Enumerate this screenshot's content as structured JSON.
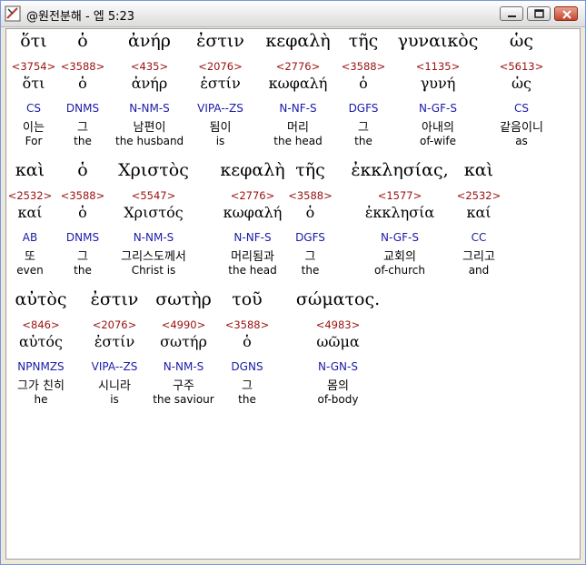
{
  "window": {
    "title": "@원전분해 - 엡 5:23"
  },
  "lines": [
    [
      {
        "greek": "ὅτι",
        "strong": "<3754>",
        "lemma": "ὅτι",
        "parse": "CS",
        "korean": "이는",
        "english": "For"
      },
      {
        "greek": "ὁ",
        "strong": "<3588>",
        "lemma": "ὁ",
        "parse": "DNMS",
        "korean": "그",
        "english": "the"
      },
      {
        "greek": "ἀνήρ",
        "strong": "<435>",
        "lemma": "ἀνήρ",
        "parse": "N-NM-S",
        "korean": "남편이",
        "english": "the husband"
      },
      {
        "greek": "ἐστιν",
        "strong": "<2076>",
        "lemma": "ἐστίν",
        "parse": "VIPA--ZS",
        "korean": "됨이",
        "english": "is"
      },
      {
        "greek": "κεφαλὴ",
        "strong": "<2776>",
        "lemma": "κωφαλή",
        "parse": "N-NF-S",
        "korean": "머리",
        "english": "the head"
      },
      {
        "greek": "τῆς",
        "strong": "<3588>",
        "lemma": "ὁ",
        "parse": "DGFS",
        "korean": "그",
        "english": "the"
      },
      {
        "greek": "γυναικὸς",
        "strong": "<1135>",
        "lemma": "γυνή",
        "parse": "N-GF-S",
        "korean": "아내의",
        "english": "of-wife"
      },
      {
        "greek": "ὡς",
        "strong": "<5613>",
        "lemma": "ὡς",
        "parse": "CS",
        "korean": "같음이니",
        "english": "as"
      }
    ],
    [
      {
        "greek": "καὶ",
        "strong": "<2532>",
        "lemma": "καί",
        "parse": "AB",
        "korean": "또",
        "english": "even"
      },
      {
        "greek": "ὁ",
        "strong": "<3588>",
        "lemma": "ὁ",
        "parse": "DNMS",
        "korean": "그",
        "english": "the"
      },
      {
        "greek": "Χριστὸς",
        "strong": "<5547>",
        "lemma": "Χριστός",
        "parse": "N-NM-S",
        "korean": "그리스도께서",
        "english": "Christ is"
      },
      {
        "greek": "κεφαλὴ",
        "strong": "<2776>",
        "lemma": "κωφαλή",
        "parse": "N-NF-S",
        "korean": "머리됨과",
        "english": "the head"
      },
      {
        "greek": "τῆς",
        "strong": "<3588>",
        "lemma": "ὁ",
        "parse": "DGFS",
        "korean": "그",
        "english": "the"
      },
      {
        "greek": "ἐκκλησίας,",
        "strong": "<1577>",
        "lemma": "ἐκκλησία",
        "parse": "N-GF-S",
        "korean": "교회의",
        "english": "of-church"
      },
      {
        "greek": "καὶ",
        "strong": "<2532>",
        "lemma": "καί",
        "parse": "CC",
        "korean": "그리고",
        "english": "and"
      }
    ],
    [
      {
        "greek": "αὐτὸς",
        "strong": "<846>",
        "lemma": "αὐτός",
        "parse": "NPNMZS",
        "korean": "그가 친히",
        "english": "he"
      },
      {
        "greek": "ἐστιν",
        "strong": "<2076>",
        "lemma": "ἐστίν",
        "parse": "VIPA--ZS",
        "korean": "시니라",
        "english": "is"
      },
      {
        "greek": "σωτὴρ",
        "strong": "<4990>",
        "lemma": "σωτήρ",
        "parse": "N-NM-S",
        "korean": "구주",
        "english": "the saviour"
      },
      {
        "greek": "τοῦ",
        "strong": "<3588>",
        "lemma": "ὁ",
        "parse": "DGNS",
        "korean": "그",
        "english": "the"
      },
      {
        "greek": "σώματος.",
        "strong": "<4983>",
        "lemma": "ωῶμα",
        "parse": "N-GN-S",
        "korean": "몸의",
        "english": "of-body"
      }
    ]
  ]
}
